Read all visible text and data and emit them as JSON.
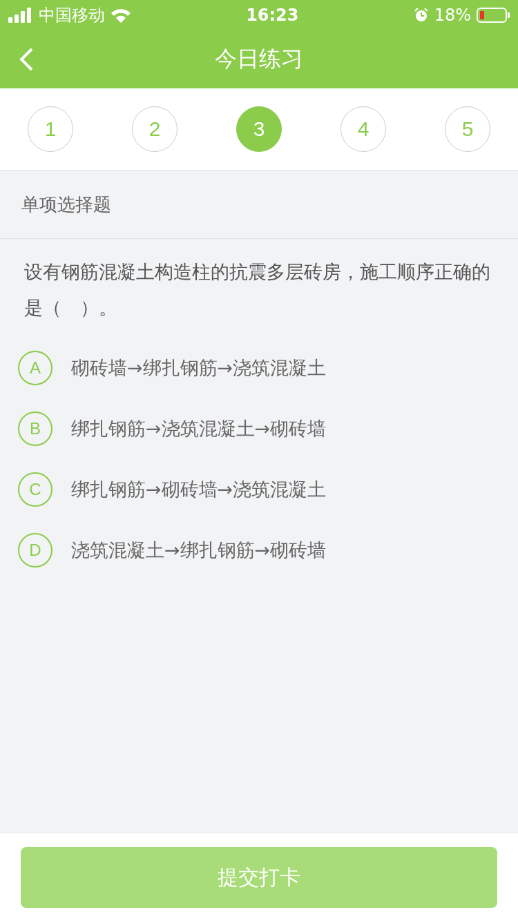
{
  "status_bar": {
    "carrier": "中国移动",
    "time": "16:23",
    "battery": "18%"
  },
  "header": {
    "title": "今日练习"
  },
  "steps": [
    {
      "label": "1",
      "selected": false
    },
    {
      "label": "2",
      "selected": false
    },
    {
      "label": "3",
      "selected": true
    },
    {
      "label": "4",
      "selected": false
    },
    {
      "label": "5",
      "selected": false
    }
  ],
  "section": {
    "title": "单项选择题"
  },
  "question": {
    "text": "设有钢筋混凝土构造柱的抗震多层砖房，施工顺序正确的是（　）。"
  },
  "options": [
    {
      "letter": "A",
      "text": "砌砖墙→绑扎钢筋→浇筑混凝土",
      "selected": false
    },
    {
      "letter": "B",
      "text": "绑扎钢筋→浇筑混凝土→砌砖墙",
      "selected": false
    },
    {
      "letter": "C",
      "text": "绑扎钢筋→砌砖墙→浇筑混凝土",
      "selected": false
    },
    {
      "letter": "D",
      "text": "浇筑混凝土→绑扎钢筋→砌砖墙",
      "selected": false
    }
  ],
  "submit": {
    "label": "提交打卡",
    "disabled": true
  }
}
